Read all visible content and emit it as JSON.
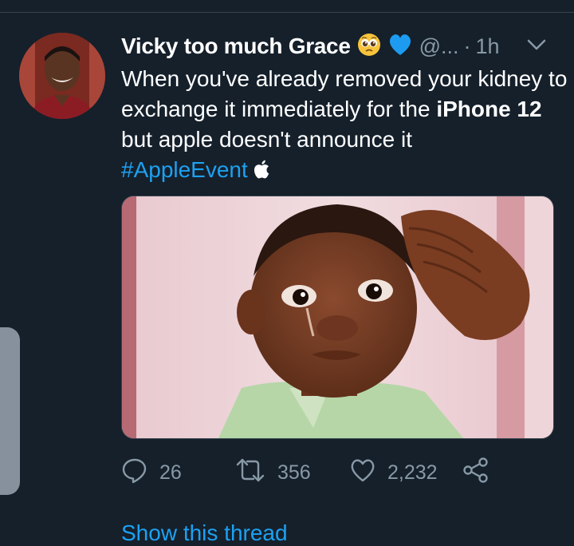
{
  "tweet": {
    "display_name": "Vicky too much Grace",
    "name_emojis": [
      "pleading-face-emoji",
      "blue-heart-emoji"
    ],
    "handle": "@...",
    "separator": "·",
    "time": "1h",
    "text_part1": "When you've already removed your kidney to exchange it immediately for the ",
    "text_bold": "iPhone 12",
    "text_part2": " but apple doesn't announce it",
    "hashtag": "#AppleEvent",
    "hashtag_icon": "apple-logo-icon",
    "media_description": "photo of a tearful child holding a hand to his head"
  },
  "actions": {
    "reply_count": "26",
    "retweet_count": "356",
    "like_count": "2,232"
  },
  "footer": {
    "show_thread_label": "Show this thread"
  },
  "colors": {
    "background": "#15202b",
    "link": "#1da1f2",
    "secondary_text": "#8899a6",
    "divider": "#38444d"
  }
}
